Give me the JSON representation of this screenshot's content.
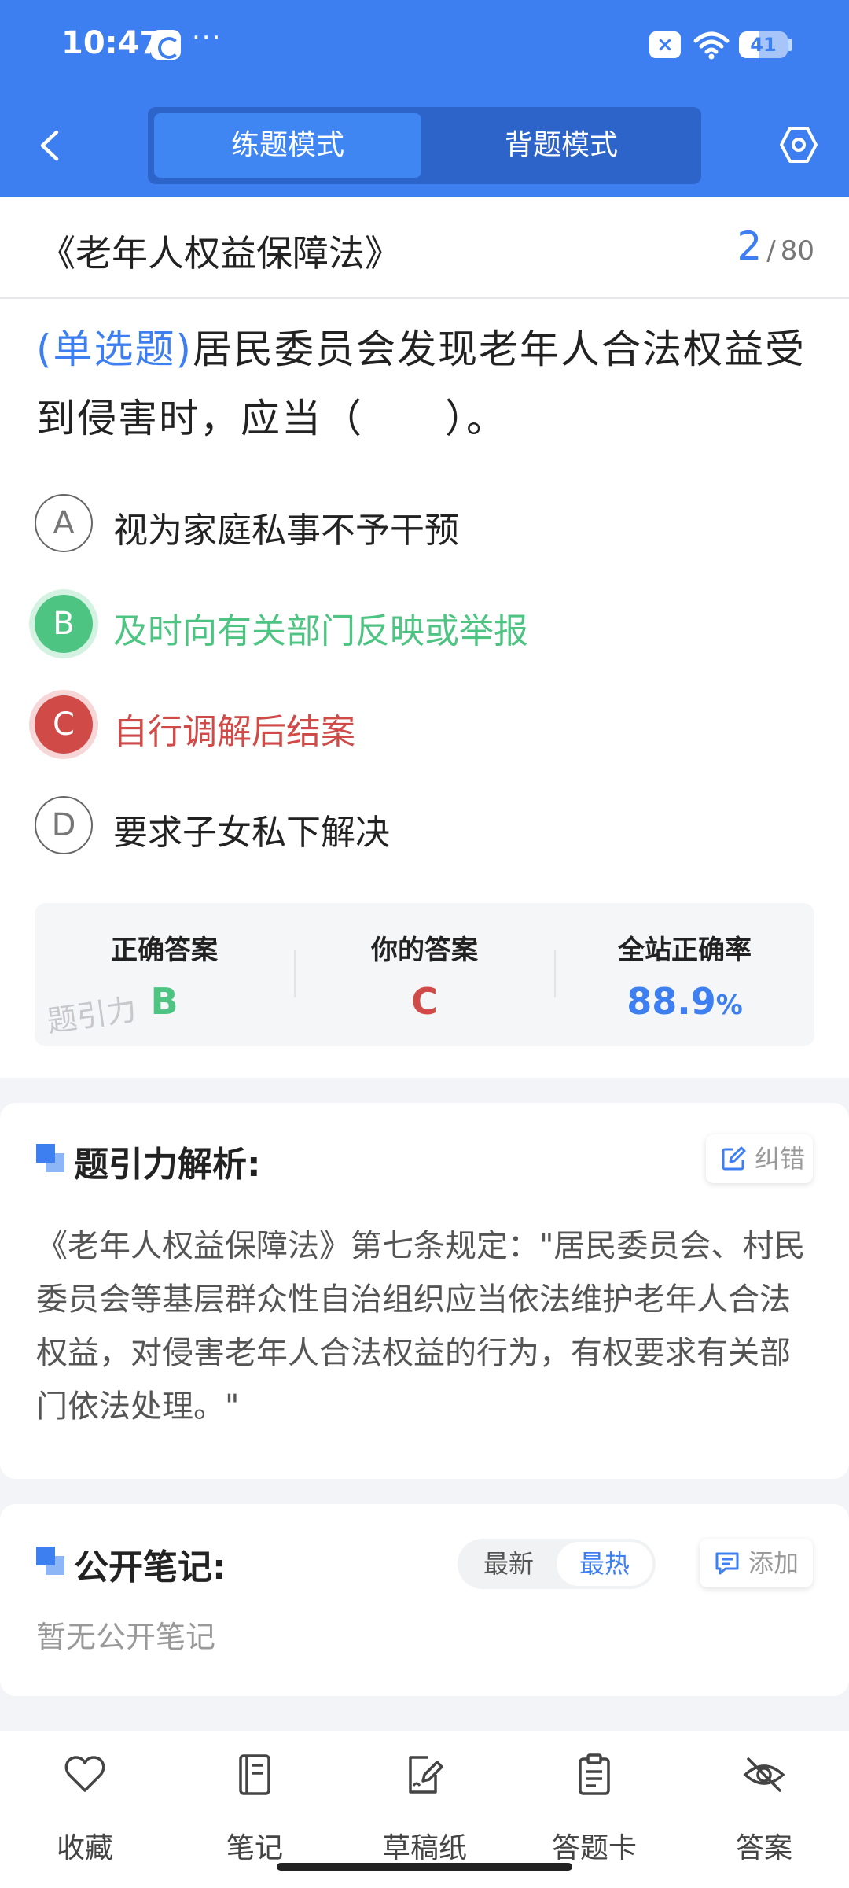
{
  "status_bar": {
    "time": "10:47",
    "dots": "···",
    "battery": "41",
    "battery_level": 0.41
  },
  "header": {
    "tabs": [
      {
        "label": "练题模式",
        "active": true
      },
      {
        "label": "背题模式",
        "active": false
      }
    ]
  },
  "question": {
    "book_title": "《老年人权益保障法》",
    "progress_current": "2",
    "progress_sep": "/",
    "progress_total": "80",
    "type": "(单选题)",
    "text": "居民委员会发现老年人合法权益受到侵害时，应当（　　）。",
    "options": [
      {
        "letter": "A",
        "text": "视为家庭私事不予干预",
        "state": "normal"
      },
      {
        "letter": "B",
        "text": "及时向有关部门反映或举报",
        "state": "correct"
      },
      {
        "letter": "C",
        "text": "自行调解后结案",
        "state": "wrong"
      },
      {
        "letter": "D",
        "text": "要求子女私下解决",
        "state": "normal"
      }
    ]
  },
  "answer": {
    "correct_label": "正确答案",
    "correct_value": "B",
    "yours_label": "你的答案",
    "yours_value": "C",
    "rate_label": "全站正确率",
    "rate_value": "88.9",
    "rate_unit": "%",
    "watermark": "题引力"
  },
  "analysis": {
    "title": "题引力解析:",
    "report_label": "纠错",
    "text": "《老年人权益保障法》第七条规定：\"居民委员会、村民委员会等基层群众性自治组织应当依法维护老年人合法权益，对侵害老年人合法权益的行为，有权要求有关部门依法处理。\""
  },
  "notes": {
    "title": "公开笔记:",
    "sort_latest": "最新",
    "sort_hot": "最热",
    "add_label": "添加",
    "empty_text": "暂无公开笔记"
  },
  "bottom_bar": {
    "items": [
      {
        "label": "收藏",
        "icon": "heart-icon"
      },
      {
        "label": "笔记",
        "icon": "notebook-icon"
      },
      {
        "label": "草稿纸",
        "icon": "draft-icon"
      },
      {
        "label": "答题卡",
        "icon": "clipboard-icon"
      },
      {
        "label": "答案",
        "icon": "eye-off-icon"
      }
    ]
  },
  "colors": {
    "primary": "#3d7ff0",
    "correct": "#4ec483",
    "wrong": "#d04a48"
  }
}
